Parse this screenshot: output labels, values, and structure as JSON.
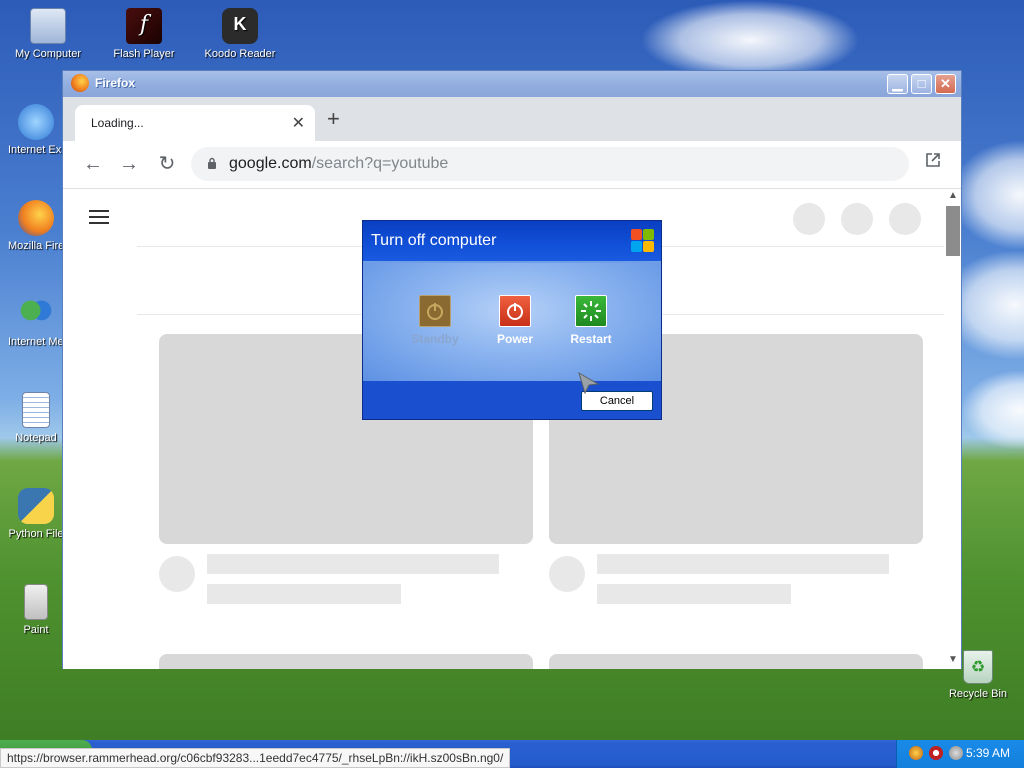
{
  "desktop": {
    "icons": [
      {
        "label": "My Computer",
        "icon": "my-computer-icon"
      },
      {
        "label": "Flash Player",
        "icon": "flash-player-icon"
      },
      {
        "label": "Koodo Reader",
        "icon": "koodo-reader-icon"
      },
      {
        "label": "Internet Explorer",
        "icon": "internet-explorer-icon"
      },
      {
        "label": "Mozilla Firefox",
        "icon": "firefox-icon"
      },
      {
        "label": "Internet Messenger",
        "icon": "messenger-icon"
      },
      {
        "label": "Notepad",
        "icon": "notepad-icon"
      },
      {
        "label": "Python File",
        "icon": "python-icon"
      },
      {
        "label": "Paint",
        "icon": "paint-icon"
      }
    ],
    "recycle_bin_label": "Recycle Bin"
  },
  "browser": {
    "window_title": "Firefox",
    "tab_title": "Loading...",
    "tab_close": "✕",
    "new_tab": "+",
    "url_host": "google.com",
    "url_path": "/search?q=youtube"
  },
  "dialog": {
    "title": "Turn off computer",
    "options": [
      {
        "label": "Standby",
        "enabled": false,
        "icon": "standby-icon"
      },
      {
        "label": "Power",
        "enabled": true,
        "icon": "power-icon"
      },
      {
        "label": "Restart",
        "enabled": true,
        "icon": "restart-icon"
      }
    ],
    "cancel_label": "Cancel"
  },
  "statusbar": {
    "url": "https://browser.rammerhead.org/c06cbf93283...1eedd7ec4775/_rhseLpBn://ikH.sz00sBn.ng0/"
  },
  "taskbar": {
    "clock": "5:39 AM"
  },
  "colors": {
    "dialog_title_bg": "#0a3fc2",
    "power_red": "#d84020",
    "restart_green": "#2a9a2a",
    "taskbar_blue": "#245ccc"
  }
}
